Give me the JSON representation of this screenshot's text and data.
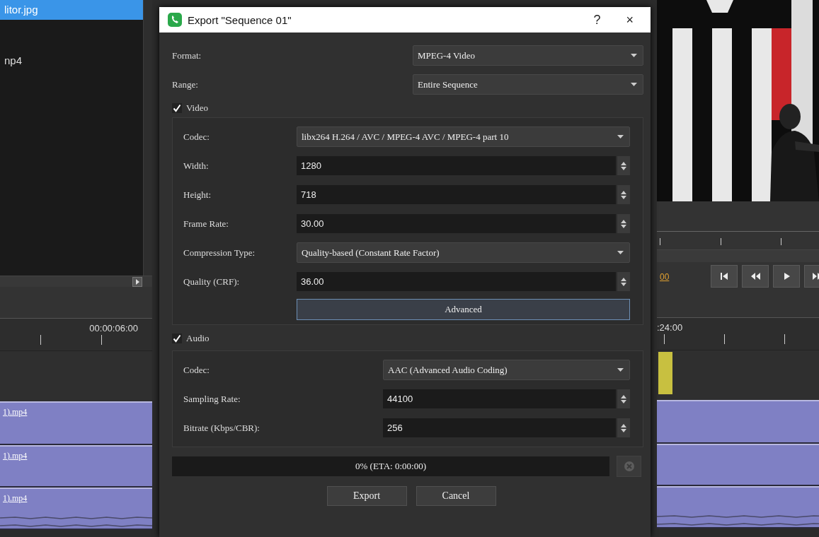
{
  "project_panel": {
    "items": [
      {
        "label": "litor.jpg",
        "selected": true
      },
      {
        "label": "np4",
        "selected": false
      }
    ]
  },
  "viewer": {
    "timecode": "00"
  },
  "timeline": {
    "ruler_left": "00:00:06:00",
    "ruler_right": ":24:00",
    "clips": [
      {
        "label": "1).mp4",
        "kind": "video"
      },
      {
        "label": "1).mp4",
        "kind": "video"
      },
      {
        "label": "1).mp4",
        "kind": "audio"
      }
    ]
  },
  "dialog": {
    "title": "Export \"Sequence 01\"",
    "help": "?",
    "close": "×",
    "settings": [
      {
        "label": "Format:",
        "value": "MPEG-4 Video",
        "kind": "combo"
      },
      {
        "label": "Range:",
        "value": "Entire Sequence",
        "kind": "combo"
      }
    ],
    "video": {
      "label": "Video",
      "checked": true,
      "fields": [
        {
          "label": "Codec:",
          "value": "libx264 H.264 / AVC / MPEG-4 AVC / MPEG-4 part 10",
          "kind": "combo"
        },
        {
          "label": "Width:",
          "value": "1280",
          "kind": "spin"
        },
        {
          "label": "Height:",
          "value": "718",
          "kind": "spin"
        },
        {
          "label": "Frame Rate:",
          "value": "30.00",
          "kind": "spin"
        },
        {
          "label": "Compression Type:",
          "value": "Quality-based (Constant Rate Factor)",
          "kind": "combo"
        },
        {
          "label": "Quality (CRF):",
          "value": "36.00",
          "kind": "spin"
        }
      ],
      "advanced": "Advanced"
    },
    "audio": {
      "label": "Audio",
      "checked": true,
      "fields": [
        {
          "label": "Codec:",
          "value": "AAC (Advanced Audio Coding)",
          "kind": "combo"
        },
        {
          "label": "Sampling Rate:",
          "value": "44100",
          "kind": "spin"
        },
        {
          "label": "Bitrate (Kbps/CBR):",
          "value": "256",
          "kind": "spin"
        }
      ]
    },
    "progress": {
      "text": "0% (ETA: 0:00:00)",
      "level": 0
    },
    "stop": {
      "disabled": true
    },
    "buttons": [
      "Export",
      "Cancel"
    ]
  }
}
